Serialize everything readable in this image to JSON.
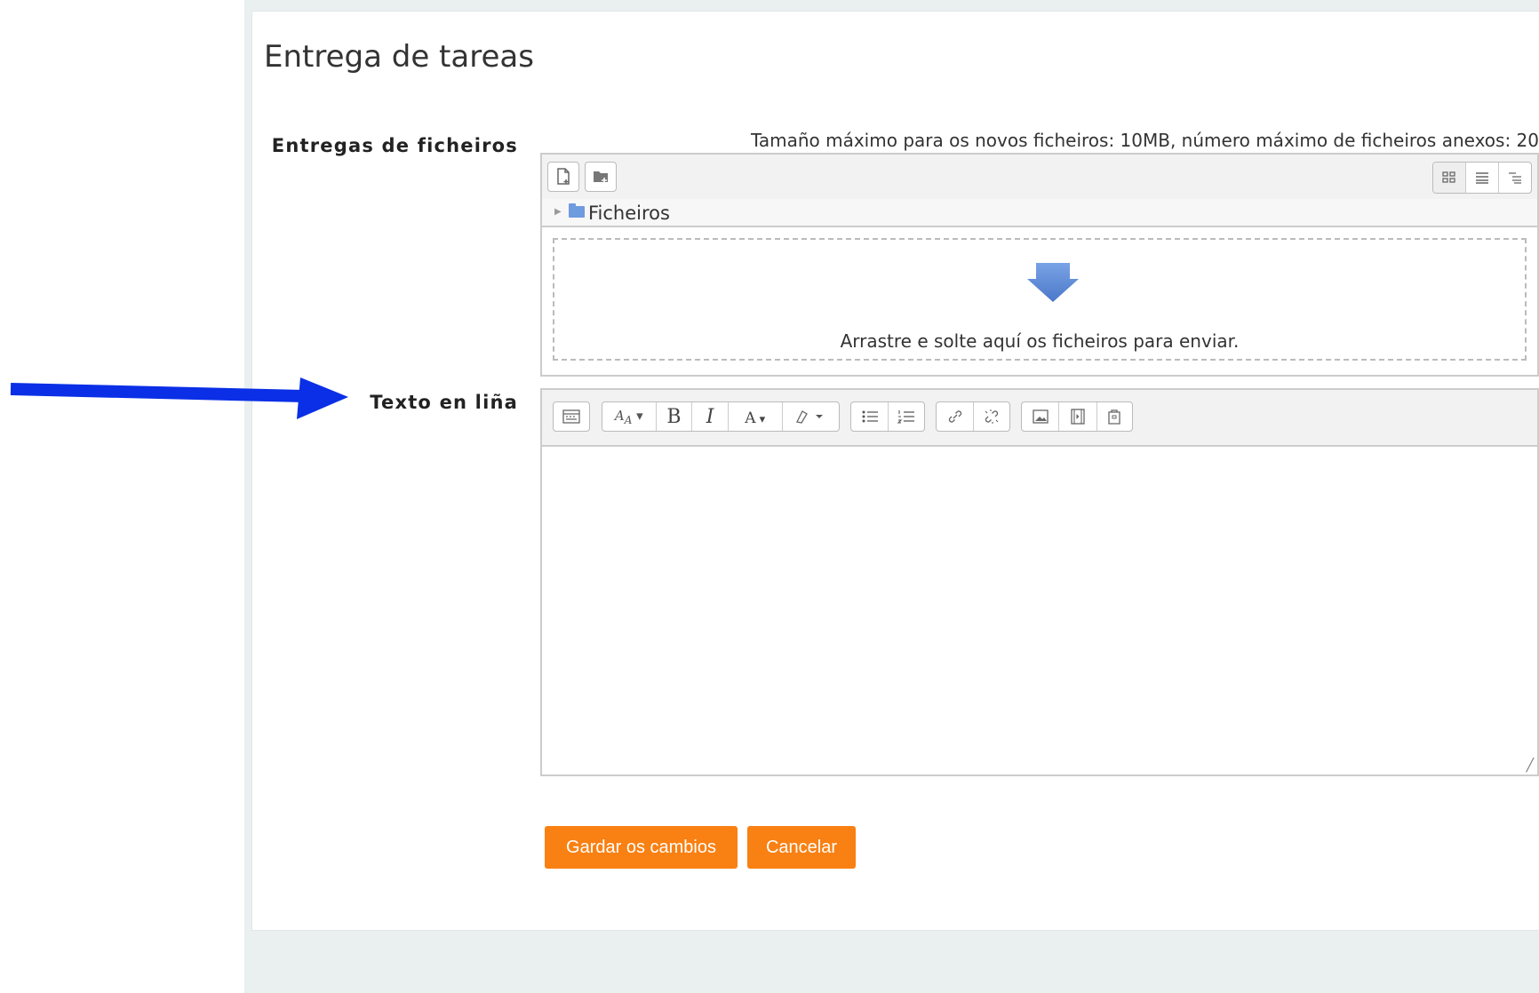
{
  "page_title": "Entrega de tareas",
  "fields": {
    "files_label": "Entregas de ficheiros",
    "online_text_label": "Texto en liña"
  },
  "filemanager": {
    "limits_text": "Tamaño máximo para os novos ficheiros: 10MB, número máximo de ficheiros anexos: 20",
    "path_folder": "Ficheiros",
    "dropzone_text": "Arrastre e solte aquí os ficheiros para enviar."
  },
  "editor": {
    "toolbar_bold": "B",
    "toolbar_italic": "I",
    "toolbar_font_color": "A"
  },
  "buttons": {
    "save": "Gardar os cambios",
    "cancel": "Cancelar"
  },
  "colors": {
    "accent": "#f98012",
    "annotation_arrow": "#0a2fe6"
  }
}
